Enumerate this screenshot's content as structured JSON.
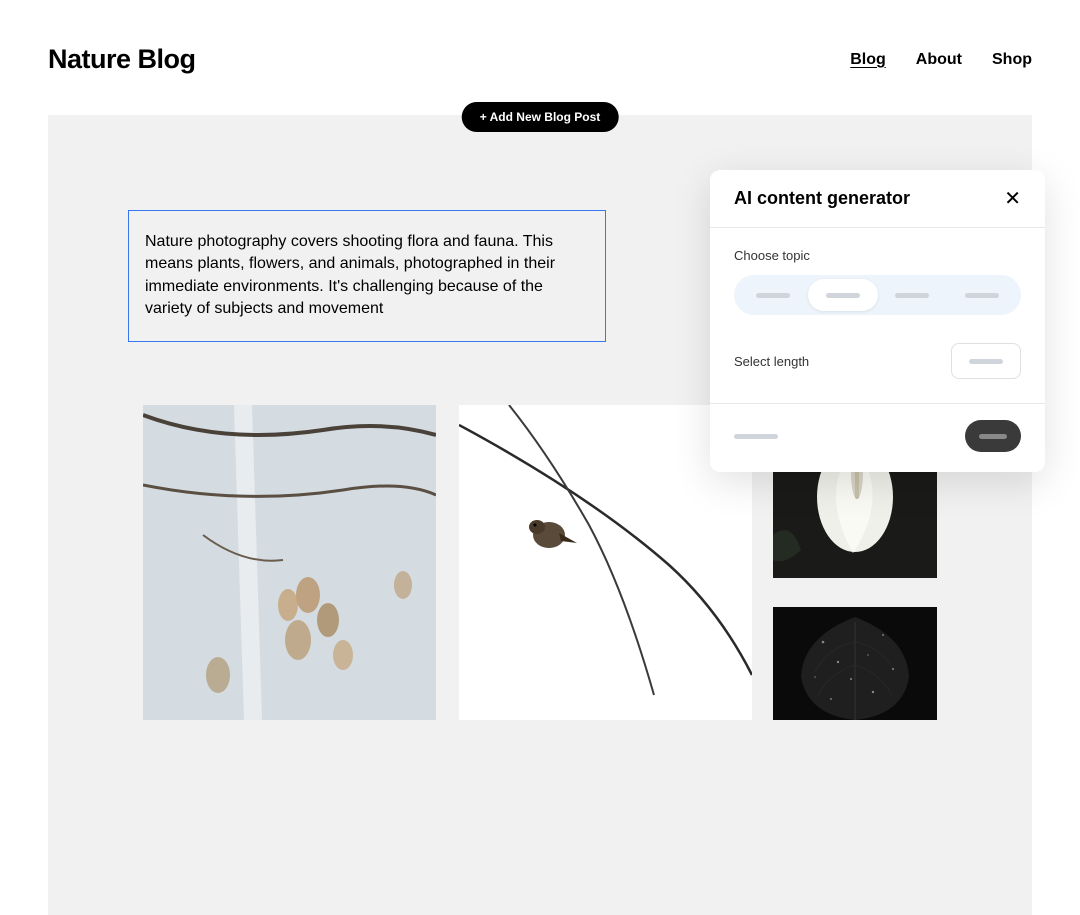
{
  "header": {
    "title": "Nature Blog",
    "nav": [
      {
        "label": "Blog",
        "active": true
      },
      {
        "label": "About",
        "active": false
      },
      {
        "label": "Shop",
        "active": false
      }
    ]
  },
  "toolbar": {
    "add_button_label": "+ Add New Blog Post"
  },
  "editor": {
    "text_content": "Nature photography covers shooting flora and fauna. This means plants, flowers, and animals, photographed in their immediate environments. It's challenging because of the variety of subjects and movement"
  },
  "ai_panel": {
    "title": "AI content generator",
    "topic_label": "Choose topic",
    "length_label": "Select length",
    "topic_options_count": 4,
    "topic_selected_index": 1
  },
  "images": {
    "branches_alt": "Tree branches with dried leaves",
    "bird_alt": "Small bird on curved wire",
    "flower_alt": "White peace lily flower on dark background",
    "leaf_alt": "Dark heart-shaped leaf with water droplets"
  }
}
